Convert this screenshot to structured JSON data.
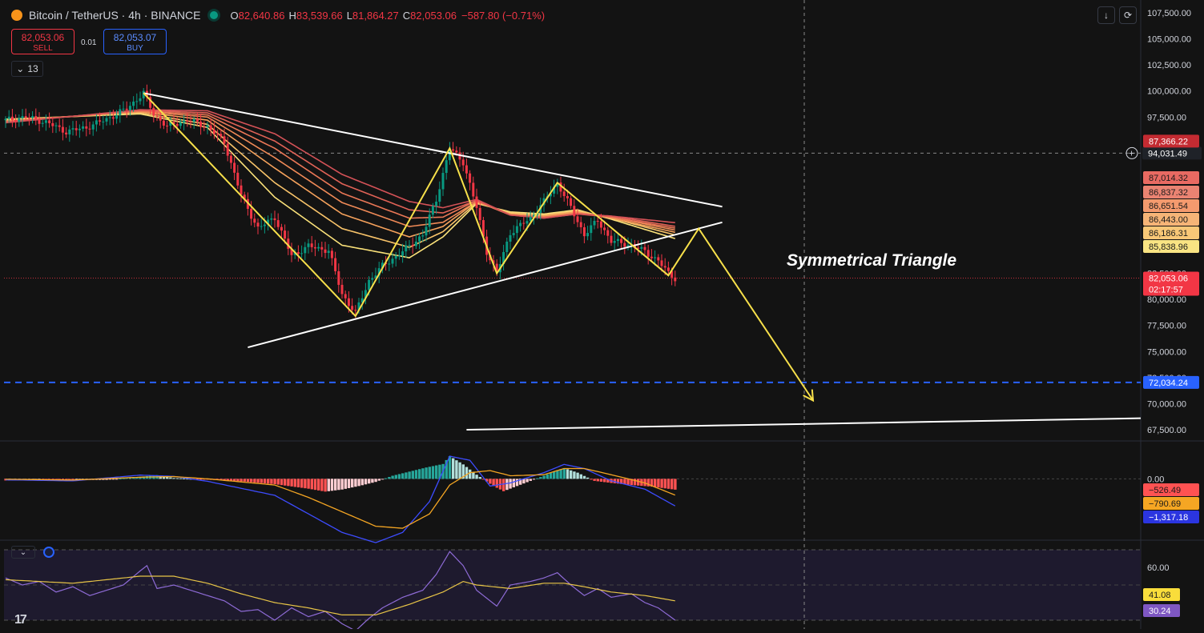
{
  "header": {
    "symbol": "Bitcoin / TetherUS · 4h · BINANCE",
    "open_label": "O",
    "open": "82,640.86",
    "high_label": "H",
    "high": "83,539.66",
    "low_label": "L",
    "low": "81,864.27",
    "close_label": "C",
    "close": "82,053.06",
    "change": "−587.80 (−0.71%)"
  },
  "trade": {
    "sell_price": "82,053.06",
    "sell_label": "SELL",
    "spread": "0.01",
    "buy_price": "82,053.07",
    "buy_label": "BUY"
  },
  "indicators_collapsed": {
    "icon": "chevron-down-icon",
    "count": "13"
  },
  "toolbar": {
    "download_icon": "arrow-down-icon",
    "replay_icon": "refresh-icon"
  },
  "colors": {
    "background": "#131313",
    "up": "#089981",
    "down": "#f23645",
    "pattern_yellow": "#f7e04a",
    "trendline": "#ffffff",
    "support_dash": "#2962ff"
  },
  "chart_data": [
    {
      "type": "candlestick",
      "title": "Bitcoin / TetherUS · 4h · BINANCE",
      "annotation": "Symmetrical Triangle",
      "ylim": [
        66500,
        108500
      ],
      "y_ticks": [
        "107,500.00",
        "105,000.00",
        "102,500.00",
        "100,000.00",
        "97,500.00",
        "94,031.49",
        "85,838.96",
        "82,500.00",
        "80,000.00",
        "77,500.00",
        "75,000.00",
        "72,500.00",
        "70,000.00",
        "67,500.00"
      ],
      "crosshair_price": "94,031.49",
      "current_price": {
        "value": "82,053.06",
        "countdown": "02:17:57"
      },
      "ribbon_labels": [
        "87,366.22",
        "87,014.32",
        "86,837.32",
        "86,651.54",
        "86,443.00",
        "86,186.31",
        "85,838.96"
      ],
      "support_level": "72,034.24",
      "price_path": [
        [
          0,
          97200
        ],
        [
          6,
          97500
        ],
        [
          12,
          97000
        ],
        [
          18,
          96100
        ],
        [
          24,
          96500
        ],
        [
          30,
          97300
        ],
        [
          36,
          98300
        ],
        [
          41,
          99800
        ],
        [
          44,
          97800
        ],
        [
          48,
          96600
        ],
        [
          54,
          97200
        ],
        [
          60,
          96600
        ],
        [
          65,
          95100
        ],
        [
          70,
          90000
        ],
        [
          75,
          86800
        ],
        [
          80,
          87900
        ],
        [
          85,
          84200
        ],
        [
          90,
          85100
        ],
        [
          96,
          84700
        ],
        [
          100,
          80500
        ],
        [
          104,
          78700
        ],
        [
          108,
          81800
        ],
        [
          112,
          83200
        ],
        [
          118,
          84600
        ],
        [
          124,
          86200
        ],
        [
          128,
          89600
        ],
        [
          132,
          94500
        ],
        [
          136,
          93200
        ],
        [
          140,
          88800
        ],
        [
          143,
          84600
        ],
        [
          146,
          82500
        ],
        [
          150,
          86400
        ],
        [
          156,
          87800
        ],
        [
          160,
          89400
        ],
        [
          164,
          91200
        ],
        [
          168,
          88800
        ],
        [
          172,
          86200
        ],
        [
          176,
          87600
        ],
        [
          180,
          85600
        ],
        [
          186,
          85200
        ],
        [
          190,
          84600
        ],
        [
          194,
          83700
        ],
        [
          197,
          82500
        ],
        [
          199,
          82053
        ]
      ],
      "ribbon_emas": [
        {
          "name": "",
          "color": "#fbe27a",
          "values": [
            [
              0,
              97300
            ],
            [
              40,
              97800
            ],
            [
              60,
              96500
            ],
            [
              80,
              89800
            ],
            [
              100,
              85200
            ],
            [
              120,
              84000
            ],
            [
              130,
              86000
            ],
            [
              140,
              89200
            ],
            [
              150,
              88400
            ],
            [
              160,
              88200
            ],
            [
              170,
              88600
            ],
            [
              180,
              87700
            ],
            [
              199,
              85839
            ]
          ]
        },
        {
          "name": "",
          "color": "#f9c46a",
          "values": [
            [
              0,
              97200
            ],
            [
              40,
              97900
            ],
            [
              60,
              96800
            ],
            [
              80,
              91200
            ],
            [
              100,
              86800
            ],
            [
              120,
              85000
            ],
            [
              130,
              86500
            ],
            [
              140,
              89300
            ],
            [
              150,
              88300
            ],
            [
              160,
              88100
            ],
            [
              170,
              88500
            ],
            [
              180,
              87800
            ],
            [
              199,
              86186
            ]
          ]
        },
        {
          "name": "",
          "color": "#f6a25c",
          "values": [
            [
              0,
              97150
            ],
            [
              40,
              98000
            ],
            [
              60,
              97200
            ],
            [
              80,
              92600
            ],
            [
              100,
              88200
            ],
            [
              120,
              86000
            ],
            [
              130,
              87000
            ],
            [
              140,
              89400
            ],
            [
              150,
              88200
            ],
            [
              160,
              88000
            ],
            [
              170,
              88400
            ],
            [
              180,
              87800
            ],
            [
              199,
              86443
            ]
          ]
        },
        {
          "name": "",
          "color": "#f08a57",
          "values": [
            [
              0,
              97100
            ],
            [
              40,
              98050
            ],
            [
              60,
              97500
            ],
            [
              80,
              93600
            ],
            [
              100,
              89300
            ],
            [
              120,
              87000
            ],
            [
              130,
              87400
            ],
            [
              140,
              89400
            ],
            [
              150,
              88100
            ],
            [
              160,
              87900
            ],
            [
              170,
              88300
            ],
            [
              180,
              87900
            ],
            [
              199,
              86652
            ]
          ]
        },
        {
          "name": "",
          "color": "#ea7756",
          "values": [
            [
              0,
              97050
            ],
            [
              40,
              98100
            ],
            [
              60,
              97700
            ],
            [
              80,
              94500
            ],
            [
              100,
              90200
            ],
            [
              120,
              87800
            ],
            [
              130,
              87900
            ],
            [
              140,
              89500
            ],
            [
              150,
              88100
            ],
            [
              160,
              87900
            ],
            [
              170,
              88200
            ],
            [
              180,
              87900
            ],
            [
              199,
              86837
            ]
          ]
        },
        {
          "name": "",
          "color": "#e06256",
          "values": [
            [
              0,
              97000
            ],
            [
              40,
              98150
            ],
            [
              60,
              97900
            ],
            [
              80,
              95200
            ],
            [
              100,
              91100
            ],
            [
              120,
              88600
            ],
            [
              130,
              88300
            ],
            [
              140,
              89500
            ],
            [
              150,
              88100
            ],
            [
              160,
              87800
            ],
            [
              170,
              88200
            ],
            [
              180,
              88000
            ],
            [
              199,
              87014
            ]
          ]
        },
        {
          "name": "",
          "color": "#d45257",
          "values": [
            [
              0,
              96950
            ],
            [
              40,
              98200
            ],
            [
              60,
              98100
            ],
            [
              80,
              95900
            ],
            [
              100,
              92000
            ],
            [
              120,
              89400
            ],
            [
              130,
              88800
            ],
            [
              140,
              89600
            ],
            [
              150,
              88100
            ],
            [
              160,
              87800
            ],
            [
              170,
              88200
            ],
            [
              180,
              88000
            ],
            [
              199,
              87366
            ]
          ]
        }
      ],
      "drawings": {
        "triangle_upper": [
          [
            41,
            99800
          ],
          [
            213,
            88900
          ]
        ],
        "triangle_lower": [
          [
            72,
            75400
          ],
          [
            213,
            87400
          ]
        ],
        "zigzag": [
          [
            41,
            99800
          ],
          [
            104,
            78400
          ],
          [
            132,
            94500
          ],
          [
            146,
            82500
          ],
          [
            164,
            91200
          ],
          [
            197,
            82300
          ],
          [
            206,
            86800
          ],
          [
            240,
            70300
          ]
        ],
        "long_trendline": [
          [
            137,
            67500
          ],
          [
            330,
            68600
          ]
        ],
        "support_dash": 72034
      }
    },
    {
      "type": "histogram",
      "title": "",
      "ylim": [
        -2900,
        1800
      ],
      "y_ticks": [
        "0.00"
      ],
      "value_labels": [
        "−526.49",
        "−790.69",
        "−1,317.18"
      ],
      "histogram": [
        [
          0,
          -80
        ],
        [
          10,
          -40
        ],
        [
          20,
          -60
        ],
        [
          30,
          -50
        ],
        [
          40,
          100
        ],
        [
          45,
          180
        ],
        [
          50,
          40
        ],
        [
          60,
          -40
        ],
        [
          70,
          -120
        ],
        [
          80,
          -260
        ],
        [
          90,
          -480
        ],
        [
          95,
          -620
        ],
        [
          100,
          -520
        ],
        [
          105,
          -350
        ],
        [
          110,
          -150
        ],
        [
          115,
          150
        ],
        [
          120,
          350
        ],
        [
          125,
          550
        ],
        [
          130,
          720
        ],
        [
          132,
          1100
        ],
        [
          136,
          700
        ],
        [
          140,
          200
        ],
        [
          145,
          -350
        ],
        [
          148,
          -600
        ],
        [
          152,
          -350
        ],
        [
          156,
          -100
        ],
        [
          160,
          150
        ],
        [
          164,
          420
        ],
        [
          166,
          520
        ],
        [
          170,
          300
        ],
        [
          175,
          -100
        ],
        [
          180,
          -200
        ],
        [
          186,
          -300
        ],
        [
          192,
          -380
        ],
        [
          199,
          -526
        ]
      ],
      "macd_line": [
        [
          0,
          -50
        ],
        [
          20,
          -100
        ],
        [
          40,
          180
        ],
        [
          50,
          120
        ],
        [
          60,
          -120
        ],
        [
          80,
          -800
        ],
        [
          90,
          -1700
        ],
        [
          100,
          -2600
        ],
        [
          110,
          -3100
        ],
        [
          118,
          -2600
        ],
        [
          126,
          -1100
        ],
        [
          132,
          1100
        ],
        [
          138,
          900
        ],
        [
          144,
          -350
        ],
        [
          150,
          -200
        ],
        [
          160,
          300
        ],
        [
          166,
          700
        ],
        [
          172,
          500
        ],
        [
          180,
          -100
        ],
        [
          190,
          -500
        ],
        [
          199,
          -1317
        ]
      ],
      "signal_line": [
        [
          0,
          -20
        ],
        [
          20,
          -60
        ],
        [
          40,
          80
        ],
        [
          50,
          110
        ],
        [
          60,
          0
        ],
        [
          80,
          -300
        ],
        [
          90,
          -900
        ],
        [
          100,
          -1600
        ],
        [
          110,
          -2300
        ],
        [
          118,
          -2400
        ],
        [
          126,
          -1700
        ],
        [
          132,
          -300
        ],
        [
          138,
          300
        ],
        [
          144,
          400
        ],
        [
          150,
          150
        ],
        [
          160,
          200
        ],
        [
          166,
          500
        ],
        [
          172,
          500
        ],
        [
          180,
          200
        ],
        [
          190,
          -200
        ],
        [
          199,
          -791
        ]
      ]
    },
    {
      "type": "line",
      "title": "",
      "ylim": [
        25,
        75
      ],
      "y_ticks": [
        "60.00"
      ],
      "value_labels": [
        "41.08",
        "30.24"
      ],
      "rsi": [
        [
          0,
          54
        ],
        [
          5,
          50
        ],
        [
          10,
          52
        ],
        [
          15,
          46
        ],
        [
          20,
          49
        ],
        [
          25,
          44
        ],
        [
          30,
          47
        ],
        [
          35,
          50
        ],
        [
          40,
          58
        ],
        [
          42,
          61
        ],
        [
          45,
          48
        ],
        [
          50,
          50
        ],
        [
          55,
          47
        ],
        [
          60,
          44
        ],
        [
          65,
          41
        ],
        [
          70,
          35
        ],
        [
          75,
          36
        ],
        [
          80,
          30
        ],
        [
          85,
          37
        ],
        [
          90,
          32
        ],
        [
          95,
          35
        ],
        [
          100,
          28
        ],
        [
          104,
          24
        ],
        [
          108,
          31
        ],
        [
          112,
          37
        ],
        [
          118,
          43
        ],
        [
          124,
          47
        ],
        [
          128,
          56
        ],
        [
          132,
          69
        ],
        [
          136,
          61
        ],
        [
          140,
          47
        ],
        [
          146,
          38
        ],
        [
          150,
          50
        ],
        [
          156,
          52
        ],
        [
          160,
          54
        ],
        [
          164,
          57
        ],
        [
          168,
          50
        ],
        [
          172,
          44
        ],
        [
          176,
          48
        ],
        [
          180,
          43
        ],
        [
          186,
          45
        ],
        [
          190,
          40
        ],
        [
          194,
          37
        ],
        [
          199,
          30
        ]
      ],
      "rsi_ma": [
        [
          0,
          53
        ],
        [
          20,
          51
        ],
        [
          40,
          55
        ],
        [
          50,
          55
        ],
        [
          60,
          51
        ],
        [
          70,
          45
        ],
        [
          80,
          40
        ],
        [
          90,
          37
        ],
        [
          100,
          33
        ],
        [
          110,
          33
        ],
        [
          120,
          39
        ],
        [
          130,
          46
        ],
        [
          136,
          52
        ],
        [
          140,
          50
        ],
        [
          150,
          48
        ],
        [
          160,
          51
        ],
        [
          166,
          51
        ],
        [
          172,
          49
        ],
        [
          180,
          46
        ],
        [
          190,
          44
        ],
        [
          199,
          41
        ]
      ]
    }
  ]
}
